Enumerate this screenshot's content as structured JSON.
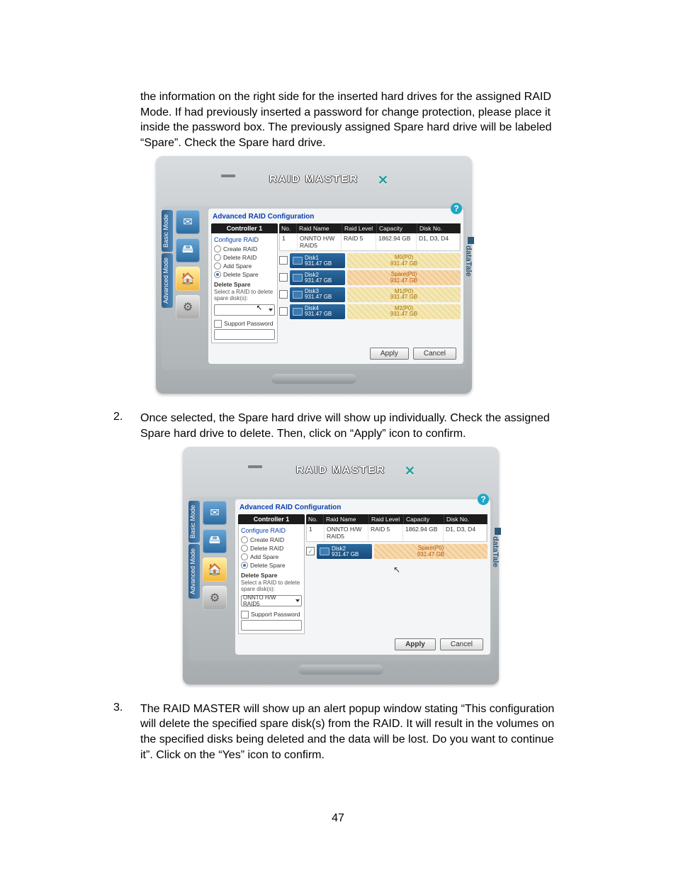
{
  "page_number": "47",
  "intro_text": "the information on the right side for the inserted hard drives for the assigned RAID Mode.  If had previously inserted a password for change protection, please place it inside the password box.  The previously assigned Spare hard drive will be labeled “Spare”.  Check the Spare hard drive.",
  "step2_text": "Once selected, the Spare hard drive will show up individually.  Check the assigned Spare hard drive to delete.  Then, click on “Apply” icon to confirm.",
  "step3_text": "The RAID MASTER will show up an alert popup window stating “This configuration will delete the specified spare disk(s) from the RAID.  It will result in the volumes on the specified disks being deleted and the data will be lost. Do you want to continue it”.  Click on the “Yes” icon to confirm.",
  "app": {
    "title": "RAID MASTER",
    "help": "?",
    "tabs": {
      "basic": "Basic Mode",
      "advanced": "Advanced Mode"
    },
    "brand": "dataTale",
    "panel_title": "Advanced RAID Configuration",
    "controller": {
      "header": "Controller 1",
      "configure": "Configure RAID",
      "opts": {
        "create": "Create RAID",
        "delete": "Delete RAID",
        "add_spare": "Add Spare",
        "delete_spare": "Delete Spare"
      },
      "sub_header": "Delete Spare",
      "hint": "Select a RAID to delete spare disk(s):",
      "combo_blank": " ",
      "combo_value": "ONNTO H/W RAID5",
      "support_pw": "Support Password"
    },
    "table": {
      "h_no": "No.",
      "h_name": "Raid Name",
      "h_level": "Raid Level",
      "h_cap": "Capacity",
      "h_disk": "Disk No.",
      "row": {
        "no": "1",
        "name": "ONNTO H/W RAID5",
        "level": "RAID 5",
        "cap": "1862.94 GB",
        "disk": "D1, D3, D4"
      }
    },
    "disks": {
      "d1": {
        "name": "Disk1",
        "size": "931.47 GB",
        "status": "M0(P0)",
        "status_size": "931.47 GB"
      },
      "d2": {
        "name": "Disk2",
        "size": "931.47 GB",
        "status": "Spare(P0)",
        "status_size": "931.47 GB"
      },
      "d3": {
        "name": "Disk3",
        "size": "931.47 GB",
        "status": "M1(P0)",
        "status_size": "931.47 GB"
      },
      "d4": {
        "name": "Disk4",
        "size": "931.47 GB",
        "status": "M2(P0)",
        "status_size": "931.47 GB"
      }
    },
    "buttons": {
      "apply": "Apply",
      "cancel": "Cancel"
    }
  }
}
